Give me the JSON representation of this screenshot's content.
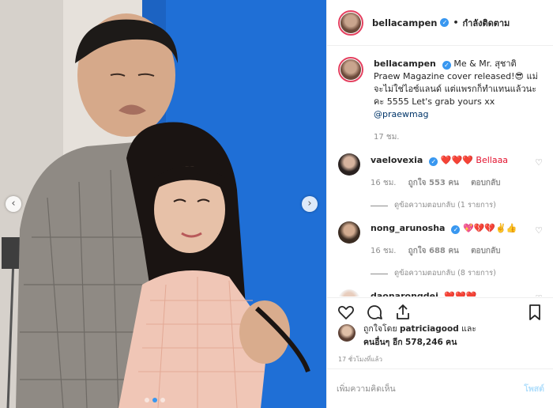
{
  "post": {
    "username": "bellacampen",
    "follow_label": "กำลังติดตาม",
    "caption_user": "bellacampen",
    "caption_text": "Me & Mr. สุชาติ Praew Magazine cover released!😎 แม่จะไม่ใช่ไอซ์แลนด์ แต่แพรกก็ทำแทนแล้วนะคะ 5555 Let's grab yours xx",
    "caption_mention": "@praewmag",
    "caption_time": "17 ชม."
  },
  "comments": [
    {
      "username": "vaelovexia",
      "text": "❤️❤️❤️ Bellaaa",
      "time": "16 ชม.",
      "likes": "ถูกใจ 553 คน",
      "reply": "ตอบกลับ",
      "view_replies": "ดูข้อความตอบกลับ (1 รายการ)"
    },
    {
      "username": "nong_arunosha",
      "text": "💖💔💔✌️👍",
      "time": "16 ชม.",
      "likes": "ถูกใจ 688 คน",
      "reply": "ตอบกลับ",
      "view_replies": "ดูข้อความตอบกลับ (8 รายการ)"
    },
    {
      "username": "daonarongdej",
      "text": "❤️❤️❤️"
    }
  ],
  "likes": {
    "line1_prefix": "ถูกใจโดย",
    "line1_user": "patriciagood",
    "line1_suffix": "และ",
    "line2_prefix": "คนอื่นๆ อีก",
    "line2_count": "578,246",
    "line2_suffix": "คน"
  },
  "timestamp": "17 ชั่วโมงที่แล้ว",
  "add_comment": {
    "placeholder": "เพิ่มความคิดเห็น",
    "post_label": "โพสต์"
  },
  "colors": {
    "accent": "#3897f0",
    "heart": "#e3122e",
    "backdrop": "#1f6fd6"
  },
  "carousel": {
    "slides": 3,
    "active": 0
  }
}
